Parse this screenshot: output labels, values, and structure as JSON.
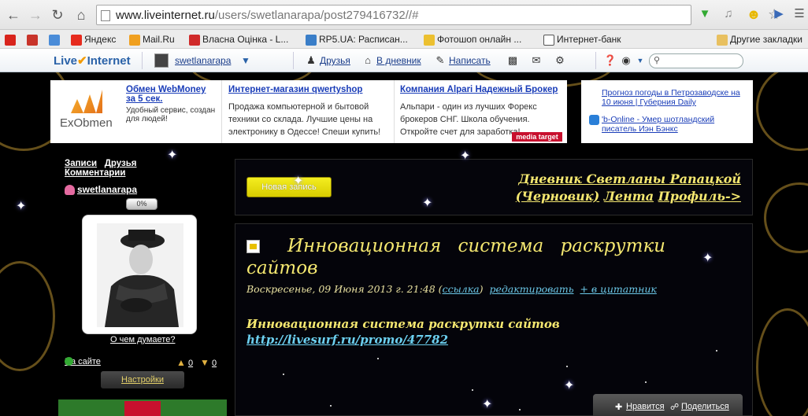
{
  "browser": {
    "url_host": "www.liveinternet.ru",
    "url_path": "/users/swetlanarapa/post279416732//#",
    "bookmarks": [
      {
        "label": "",
        "color": "#d8241c"
      },
      {
        "label": "",
        "color": "#c8342a"
      },
      {
        "label": "",
        "color": "#4a8cd8"
      },
      {
        "label": "Яндекс",
        "color": "#e62b1e"
      },
      {
        "label": "Mail.Ru",
        "color": "#f0a020"
      },
      {
        "label": "Власна Оцінка - L...",
        "color": "#d02a2a"
      },
      {
        "label": "RP5.UA: Расписан...",
        "color": "#3a7ec8"
      },
      {
        "label": "Фотошоп онлайн ...",
        "color": "#ecc030"
      },
      {
        "label": "Интернет-банк",
        "color": "#555555"
      },
      {
        "label": "Другие закладки",
        "color": "#e8c060"
      }
    ]
  },
  "li_toolbar": {
    "logo_a": "Live",
    "logo_b": "Internet",
    "username": "swetlanarapa",
    "friends": "Друзья",
    "diary": "В дневник",
    "write": "Написать",
    "search_placeholder": ""
  },
  "ads": [
    {
      "title": "Обмен WebMoney за 5 сек.",
      "text": "Удобный сервис, создан для людей!"
    },
    {
      "title": "Интернет-магазин qwertyshop",
      "text": "Продажа компьютерной и бытовой техники со склада. Лучшие цены на электронику в Одессе! Спеши купить!"
    },
    {
      "title": "Компания Alpari Надежный Брокер",
      "text": "Альпари - один из лучших Форекс брокеров СНГ. Школа обучения. Откройте счет для заработка!"
    }
  ],
  "ad_logo": "ExObmen",
  "ad_badge": "media target",
  "news": [
    "Прогноз погоды в Петрозаводске на 10 июня | Губерния Daily",
    "'b-Online - Умер шотландский писатель Иэн Бэнкс"
  ],
  "sidebar": {
    "link_posts": "Записи",
    "link_friends": "Друзья",
    "link_comments": "Комментарии",
    "username": "swetlanarapa",
    "progress": "0%",
    "think": "О чем думаете?",
    "online": "На сайте",
    "likes": "0",
    "dislikes": "0",
    "settings": "Настройки"
  },
  "header": {
    "new_post": "Новая запись",
    "diary_title": "Дневник Светланы Рапацкой (Черновик)",
    "feed": "Лента",
    "profile": "Профиль->"
  },
  "post": {
    "title": "Инновационная система раскрутки сайтов",
    "date": "Воскресенье, 09 Июня 2013 г. 21:48",
    "link_label": "ссылка",
    "edit_label": "редактировать",
    "quote_label": "+ в цитатник",
    "body_title": "Инновационная система раскрутки сайтов",
    "body_link": "http://livesurf.ru/promo/47782",
    "like": "Нравится",
    "share": "Поделиться"
  }
}
